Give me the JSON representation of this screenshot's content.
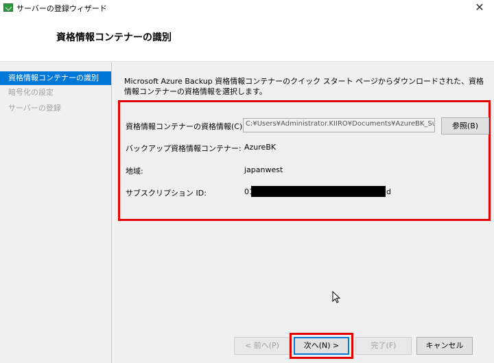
{
  "window": {
    "title": "サーバーの登録ウィザード",
    "close_glyph": "✕"
  },
  "header": {
    "title": "資格情報コンテナーの識別"
  },
  "sidebar": {
    "items": [
      {
        "label": "資格情報コンテナーの識別"
      },
      {
        "label": "暗号化の設定"
      },
      {
        "label": "サーバーの登録"
      }
    ]
  },
  "main": {
    "description": "Microsoft Azure Backup 資格情報コンテナーのクイック スタート ページからダウンロードされた、資格情報コンテナーの資格情報を選択します。",
    "credentials_label": "資格情報コンテナーの資格情報(C):",
    "credentials_value": "C:¥Users¥Administrator.KIIRO¥Documents¥AzureBK_Sun",
    "browse_label": "参照(B)",
    "vault_label": "バックアップ資格情報コンテナー:",
    "vault_value": "AzureBK",
    "region_label": "地域:",
    "region_value": "japanwest",
    "subscription_label": "サブスクリプション ID:",
    "subscription_prefix": "01",
    "subscription_suffix": "d"
  },
  "footer": {
    "back_label": "< 前へ(P)",
    "next_label": "次へ(N) >",
    "finish_label": "完了(F)",
    "cancel_label": "キャンセル"
  },
  "colors": {
    "accent": "#0078d7",
    "highlight": "#e00000",
    "app_icon": "#2e9a3e"
  },
  "icons": {
    "app": "app-icon",
    "close": "close-icon",
    "cursor": "mouse-cursor-icon"
  }
}
